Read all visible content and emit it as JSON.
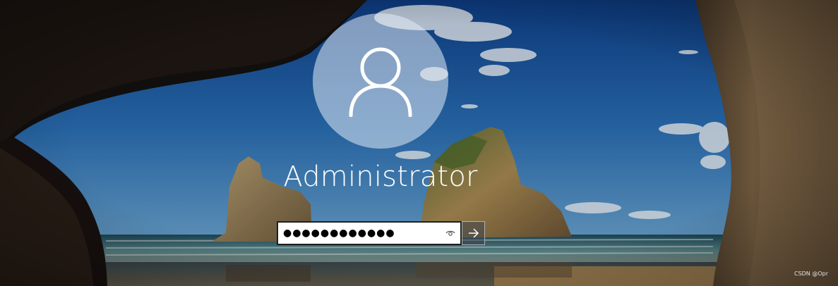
{
  "user": {
    "name": "Administrator",
    "avatar_icon": "user-silhouette-icon"
  },
  "login": {
    "password_mask": "●●●●●●●●●●●●",
    "reveal_icon": "eye-icon",
    "submit_icon": "arrow-right-icon"
  },
  "watermark": "CSDN @Opr",
  "colors": {
    "avatar_circle": "#dbe6f0",
    "text": "#ffffff",
    "input_bg": "#ffffff",
    "input_border": "#1f1f1f"
  }
}
